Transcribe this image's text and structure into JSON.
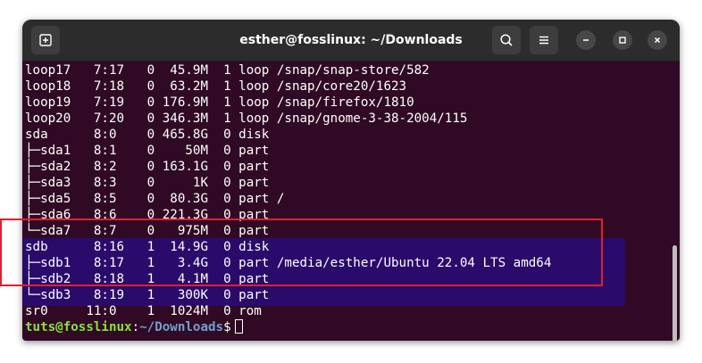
{
  "window": {
    "title": "esther@fosslinux: ~/Downloads"
  },
  "icons": {
    "new_tab": "new-tab-icon",
    "search": "search-icon",
    "menu": "hamburger-menu-icon",
    "minimize": "minimize-icon",
    "maximize": "maximize-icon",
    "close": "close-icon"
  },
  "colors": {
    "terminal_bg": "#300a24",
    "titlebar_bg": "#2c2c2c",
    "highlight_bg": "#2a0a6b",
    "annotation_border": "#e0202a",
    "prompt_user": "#8ae234",
    "prompt_path": "#729fcf"
  },
  "terminal": {
    "lines": [
      "loop17   7:17   0  45.9M  1 loop /snap/snap-store/582",
      "loop18   7:18   0  63.2M  1 loop /snap/core20/1623",
      "loop19   7:19   0 176.9M  1 loop /snap/firefox/1810",
      "loop20   7:20   0 346.3M  1 loop /snap/gnome-3-38-2004/115",
      "sda      8:0    0 465.8G  0 disk",
      "├─sda1   8:1    0    50M  0 part",
      "├─sda2   8:2    0 163.1G  0 part",
      "├─sda3   8:3    0     1K  0 part",
      "├─sda5   8:5    0  80.3G  0 part /",
      "├─sda6   8:6    0 221.3G  0 part",
      "└─sda7   8:7    0   975M  0 part",
      "sdb      8:16   1  14.9G  0 disk",
      "├─sdb1   8:17   1   3.4G  0 part /media/esther/Ubuntu 22.04 LTS amd64",
      "├─sdb2   8:18   1   4.1M  0 part",
      "└─sdb3   8:19   1   300K  0 part",
      "sr0     11:0    1  1024M  0 rom"
    ],
    "prompt": {
      "user_host": "tuts@fosslinux",
      "separator": ":",
      "path": "~/Downloads",
      "symbol": "$"
    }
  }
}
